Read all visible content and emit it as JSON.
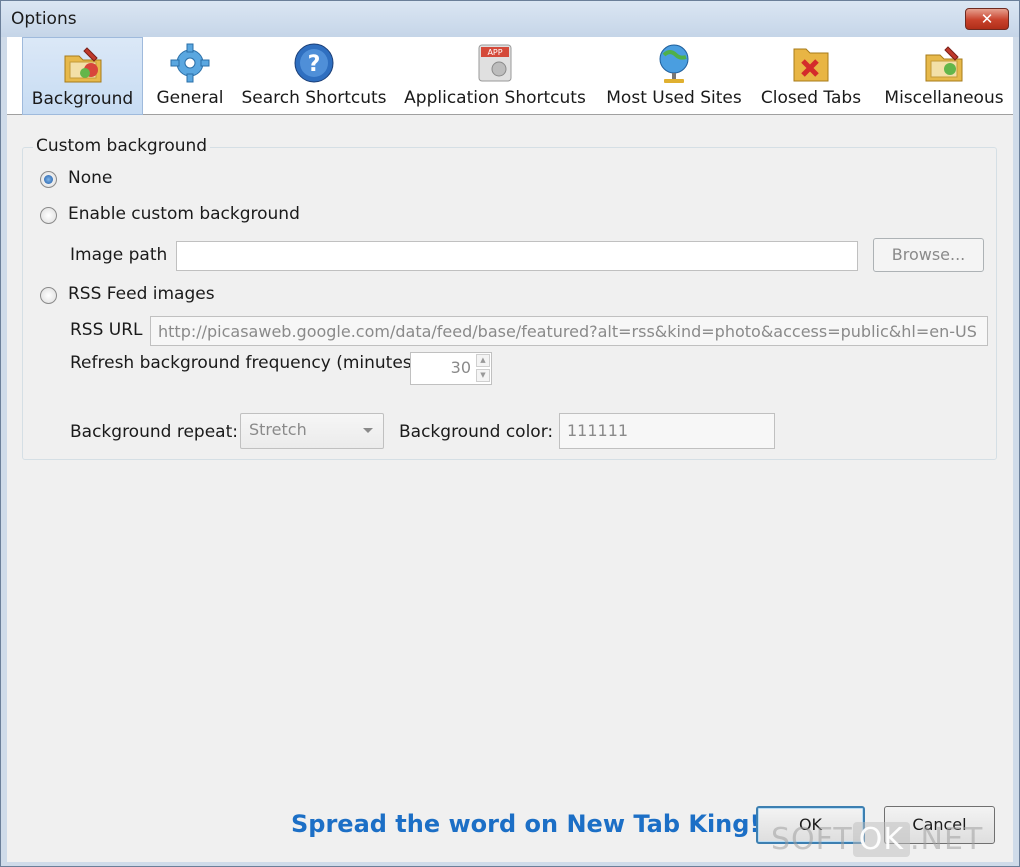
{
  "window": {
    "title": "Options",
    "close_label": "✕"
  },
  "tabs": [
    {
      "label": "Background",
      "icon": "background-icon",
      "selected": true
    },
    {
      "label": "General",
      "icon": "gear-icon",
      "selected": false
    },
    {
      "label": "Search Shortcuts",
      "icon": "search-shortcuts-icon",
      "selected": false
    },
    {
      "label": "Application Shortcuts",
      "icon": "app-shortcuts-icon",
      "selected": false
    },
    {
      "label": "Most Used Sites",
      "icon": "globe-icon",
      "selected": false
    },
    {
      "label": "Closed Tabs",
      "icon": "closed-tabs-icon",
      "selected": false
    },
    {
      "label": "Miscellaneous",
      "icon": "miscellaneous-icon",
      "selected": false
    }
  ],
  "custom_background": {
    "legend": "Custom background",
    "options": {
      "none": "None",
      "enable": "Enable custom background",
      "rss": "RSS Feed images"
    },
    "selected_option": "None",
    "image_path_label": "Image path",
    "image_path_value": "",
    "browse_label": "Browse...",
    "rss_url_label": "RSS URL",
    "rss_url_value": "http://picasaweb.google.com/data/feed/base/featured?alt=rss&kind=photo&access=public&hl=en-US",
    "refresh_label": "Refresh background frequency (minutes)",
    "refresh_value": "30",
    "repeat_label": "Background repeat:",
    "repeat_value": "Stretch",
    "color_label": "Background color:",
    "color_value": "111111"
  },
  "footer": {
    "promo_text": "Spread the word on New Tab King!",
    "ok_label": "OK",
    "cancel_label": "Cancel"
  },
  "watermark": {
    "left": "SOFT",
    "middle": "OK",
    "right": ".NET"
  },
  "colors": {
    "accent": "#1c6fc6",
    "selected_tab": "#c7dcf3",
    "close": "#c8412b"
  }
}
